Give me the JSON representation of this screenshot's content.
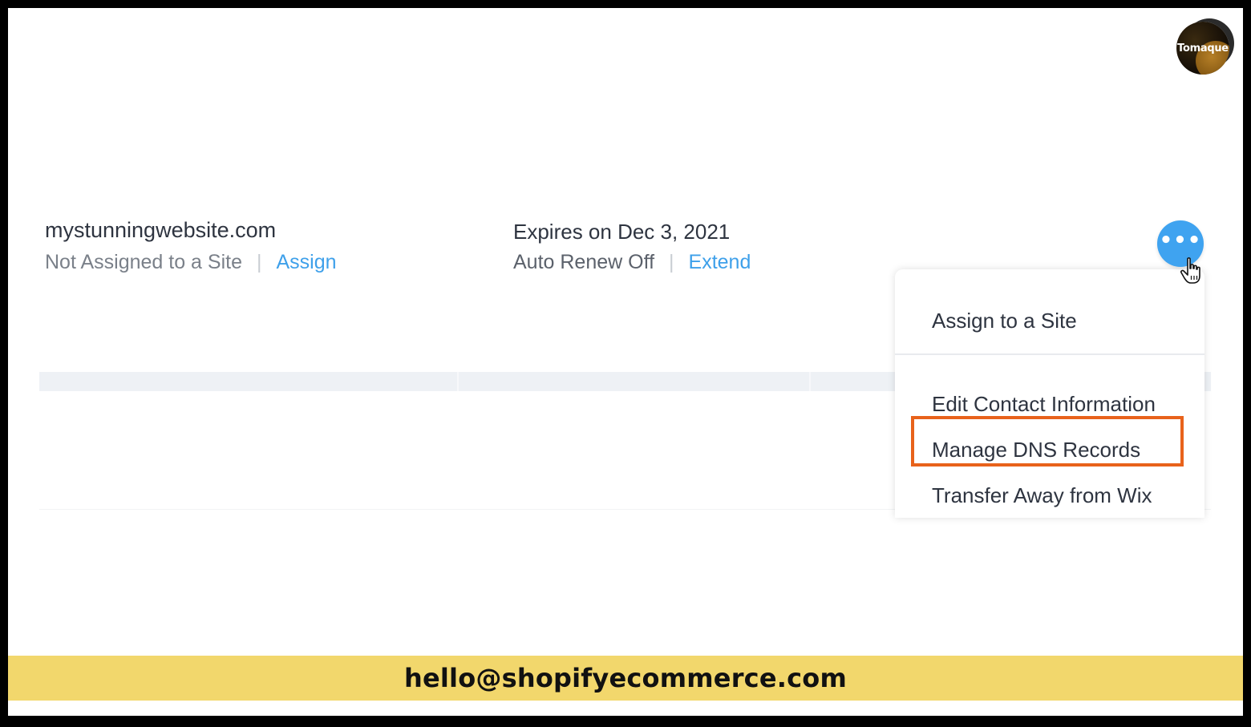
{
  "logo": {
    "text": "Tomaque"
  },
  "domain": {
    "name": "mystunningwebsite.com",
    "status": "Not Assigned to a Site",
    "separator": "|",
    "assign_link": "Assign"
  },
  "expiry": {
    "expires_text": "Expires on Dec 3, 2021",
    "renew_status": "Auto Renew Off",
    "separator": "|",
    "extend_link": "Extend"
  },
  "more_button": {
    "icon": "ellipsis-icon",
    "label": "•••"
  },
  "menu": {
    "items": [
      {
        "label": "Assign to a Site"
      },
      {
        "label": "Edit Contact Information"
      },
      {
        "label": "Manage DNS Records",
        "highlighted": true
      },
      {
        "label": "Transfer Away from Wix"
      }
    ]
  },
  "footer": {
    "email": "hello@shopifyecommerce.com"
  },
  "colors": {
    "link": "#3ea0ea",
    "button": "#3fa3f0",
    "highlight_border": "#e8621b",
    "footer_bg": "#f2d76c"
  }
}
